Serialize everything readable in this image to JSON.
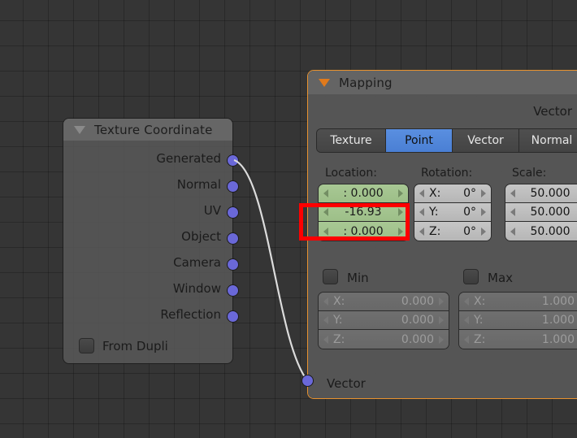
{
  "editor": {
    "name": "blender-node-editor",
    "background_color": "#353535",
    "grid_color": "#2d2d2d"
  },
  "nodes": [
    {
      "id": "texture-coordinate",
      "title": "Texture Coordinate",
      "header_triangle": "collapse-triangle-icon",
      "outputs": [
        {
          "label": "Generated",
          "socket_color": "#6a68d8",
          "connected": true
        },
        {
          "label": "Normal",
          "socket_color": "#6a68d8",
          "connected": false
        },
        {
          "label": "UV",
          "socket_color": "#6a68d8",
          "connected": false
        },
        {
          "label": "Object",
          "socket_color": "#6a68d8",
          "connected": false
        },
        {
          "label": "Camera",
          "socket_color": "#6a68d8",
          "connected": false
        },
        {
          "label": "Window",
          "socket_color": "#6a68d8",
          "connected": false
        },
        {
          "label": "Reflection",
          "socket_color": "#6a68d8",
          "connected": false
        }
      ],
      "checkbox": {
        "label": "From Dupli",
        "checked": false
      }
    },
    {
      "id": "mapping",
      "title": "Mapping",
      "header_triangle": "collapse-triangle-icon",
      "selected": true,
      "border_color": "#e8922f",
      "output_label": "Vector",
      "input_label": "Vector",
      "tabs": [
        {
          "label": "Texture",
          "active": false
        },
        {
          "label": "Point",
          "active": true
        },
        {
          "label": "Vector",
          "active": false
        },
        {
          "label": "Normal",
          "active": false
        }
      ],
      "active_tab_color": "#4a7fd4",
      "columns": [
        {
          "header": "Location:",
          "style": "driven-green",
          "color": "#a0c28b",
          "fields": [
            {
              "label": ":",
              "value": "0.000"
            },
            {
              "label": "",
              "value": "-16.93",
              "highlighted": true
            },
            {
              "label": ":",
              "value": "0.000"
            }
          ]
        },
        {
          "header": "Rotation:",
          "style": "enabled-grey",
          "fields": [
            {
              "label": "X:",
              "value": "0°"
            },
            {
              "label": "Y:",
              "value": "0°"
            },
            {
              "label": "Z:",
              "value": "0°"
            }
          ]
        },
        {
          "header": "Scale:",
          "style": "enabled-grey",
          "fields": [
            {
              "label": "",
              "value": "50.000"
            },
            {
              "label": "",
              "value": "50.000"
            },
            {
              "label": "",
              "value": "50.000"
            }
          ]
        }
      ],
      "min_group": {
        "label": "Min",
        "checked": false,
        "enabled": false,
        "fields": [
          {
            "label": "X:",
            "value": "0.000"
          },
          {
            "label": "Y:",
            "value": "0.000"
          },
          {
            "label": "Z:",
            "value": "0.000"
          }
        ]
      },
      "max_group": {
        "label": "Max",
        "checked": false,
        "enabled": false,
        "fields": [
          {
            "label": "X:",
            "value": "1.000"
          },
          {
            "label": "Y:",
            "value": "1.000"
          },
          {
            "label": "Z:",
            "value": "1.000"
          }
        ]
      }
    }
  ],
  "link": {
    "from": "Generated",
    "to": "Vector",
    "color": "#d8d8d8"
  },
  "annotation": {
    "type": "highlight-rectangle",
    "color": "#ff0000",
    "target": "mapping-location-y-field"
  }
}
